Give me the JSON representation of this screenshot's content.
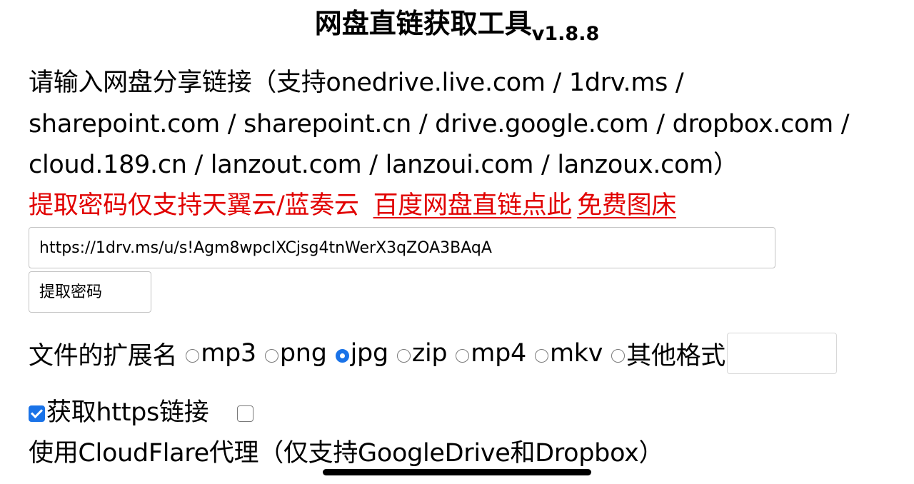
{
  "header": {
    "title": "网盘直链获取工具",
    "version": "v1.8.8"
  },
  "intro": {
    "text": "请输入网盘分享链接（支持onedrive.live.com / 1drv.ms / sharepoint.com / sharepoint.cn / drive.google.com / dropbox.com / cloud.189.cn / lanzout.com / lanzoui.com / lanzoux.com）"
  },
  "notice": {
    "text": "提取密码仅支持天翼云/蓝奏云",
    "baidu_link": "百度网盘直链点此",
    "imagebed_link": "免费图床",
    "color": "#e10000"
  },
  "form": {
    "share_link_value": "https://1drv.ms/u/s!Agm8wpcIXCjsg4tnWerX3qZOA3BAqA",
    "password_placeholder": "提取密码"
  },
  "extension": {
    "label": "文件的扩展名",
    "options": [
      {
        "label": "mp3",
        "checked": false
      },
      {
        "label": "png",
        "checked": false
      },
      {
        "label": "jpg",
        "checked": true
      },
      {
        "label": "zip",
        "checked": false
      },
      {
        "label": "mp4",
        "checked": false
      },
      {
        "label": "mkv",
        "checked": false
      },
      {
        "label": "其他格式",
        "checked": false
      }
    ],
    "other_value": ""
  },
  "options": {
    "https_label": "获取https链接",
    "https_checked": true,
    "cloudflare_label": "使用CloudFlare代理（仅支持GoogleDrive和Dropbox）",
    "cloudflare_checked": false
  },
  "accent_color": "#1a73e8"
}
